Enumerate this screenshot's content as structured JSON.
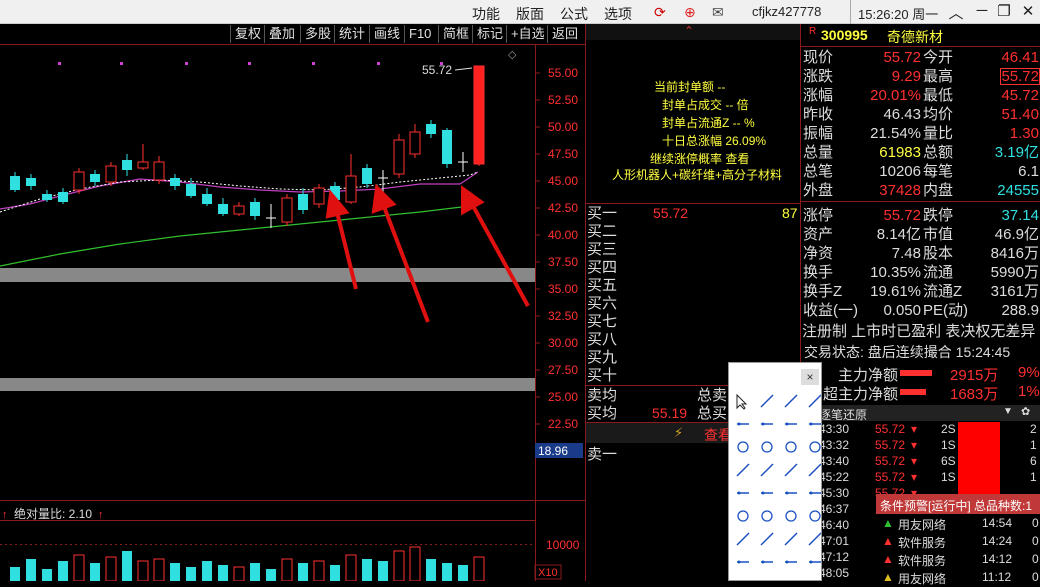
{
  "menu": {
    "items": [
      "功能",
      "版面",
      "公式",
      "选项"
    ],
    "user": "cfjkz427778",
    "time": "15:26:20 周一"
  },
  "toolbar": {
    "items": [
      "复权",
      "叠加",
      "多股",
      "统计",
      "画线",
      "F10",
      "简框",
      "标记",
      "+自选",
      "返回"
    ]
  },
  "chart": {
    "high_label": "55.72",
    "y_ticks": [
      "55.00",
      "52.50",
      "50.00",
      "47.50",
      "45.00",
      "42.50",
      "40.00",
      "37.50",
      "35.00",
      "32.50",
      "30.00",
      "27.50",
      "25.00",
      "22.50",
      "20.00"
    ],
    "low_label": "18.96",
    "volume_label": "绝对量比: 2.10",
    "volume_tick": "10000",
    "volume_unit": "X10"
  },
  "seal_panel": {
    "lines": [
      "当前封单额 --",
      "封单占成交 -- 倍",
      "封单占流通Z -- %",
      "十日总涨幅 26.09%",
      "继续涨停概率 查看"
    ],
    "concepts": "人形机器人+碳纤维+高分子材料"
  },
  "order_book": {
    "buy_labels": [
      "买一",
      "买二",
      "买三",
      "买四",
      "买五",
      "买六",
      "买七",
      "买八",
      "买九",
      "买十"
    ],
    "buy1_price": "55.72",
    "buy1_vol": "87",
    "ask_avg_label": "卖均",
    "bid_avg_label": "买均",
    "bid_avg_price": "55.19",
    "total_sell_label": "总卖",
    "total_buy_label": "总买",
    "view_label": "查看",
    "sell1_label": "卖一"
  },
  "stock": {
    "code": "300995",
    "name": "奇德新材",
    "rows": [
      [
        "现价",
        "55.72",
        "今开",
        "46.41"
      ],
      [
        "涨跌",
        "9.29",
        "最高",
        "55.72"
      ],
      [
        "涨幅",
        "20.01%",
        "最低",
        "45.72"
      ],
      [
        "昨收",
        "46.43",
        "均价",
        "51.40"
      ],
      [
        "振幅",
        "21.54%",
        "量比",
        "1.30"
      ],
      [
        "总量",
        "61983",
        "总额",
        "3.19亿"
      ],
      [
        "总笔",
        "10206",
        "每笔",
        "6.1"
      ],
      [
        "外盘",
        "37428",
        "内盘",
        "24555"
      ],
      [
        "涨停",
        "55.72",
        "跌停",
        "37.14"
      ],
      [
        "资产",
        "8.14亿",
        "市值",
        "46.9亿"
      ],
      [
        "净资",
        "7.48",
        "股本",
        "8416万"
      ],
      [
        "换手",
        "10.35%",
        "流通",
        "5990万"
      ],
      [
        "换手Z",
        "19.61%",
        "流通Z",
        "3161万"
      ],
      [
        "收益(一)",
        "0.050",
        "PE(动)",
        "288.9"
      ]
    ],
    "registration": "注册制 上市时已盈利 表决权无差异",
    "trade_status": "交易状态: 盘后连续撮合 15:24:45",
    "main_net_label": "主力净额",
    "main_net_value": "2915万",
    "main_net_pct": "9%",
    "super_net_label": "超主力净额",
    "super_net_value": "1683万",
    "super_net_pct": "1%"
  },
  "ticks": {
    "title": "逐笔还原",
    "rows": [
      [
        "43:30",
        "55.72",
        "2S",
        "2"
      ],
      [
        "43:32",
        "55.72",
        "1S",
        "1"
      ],
      [
        "43:40",
        "55.72",
        "6S",
        "6"
      ],
      [
        "45:22",
        "55.72",
        "1S",
        "1"
      ],
      [
        "45:30",
        "55.72",
        "",
        ""
      ],
      [
        "46:37",
        "",
        "",
        ""
      ],
      [
        "46:40",
        "",
        "",
        ""
      ],
      [
        "47:01",
        "",
        "",
        ""
      ],
      [
        "47:12",
        "",
        "",
        ""
      ],
      [
        "48:05",
        "",
        "",
        ""
      ]
    ]
  },
  "alerts": {
    "title": "条件预警[运行中] 总品种数:1",
    "rows": [
      [
        "用友网络",
        "14:54",
        "0"
      ],
      [
        "软件服务",
        "14:24",
        "0"
      ],
      [
        "软件服务",
        "14:12",
        "0"
      ],
      [
        "用友网络",
        "11:12",
        "0"
      ]
    ]
  },
  "drawing_palette": {
    "close": "×"
  }
}
